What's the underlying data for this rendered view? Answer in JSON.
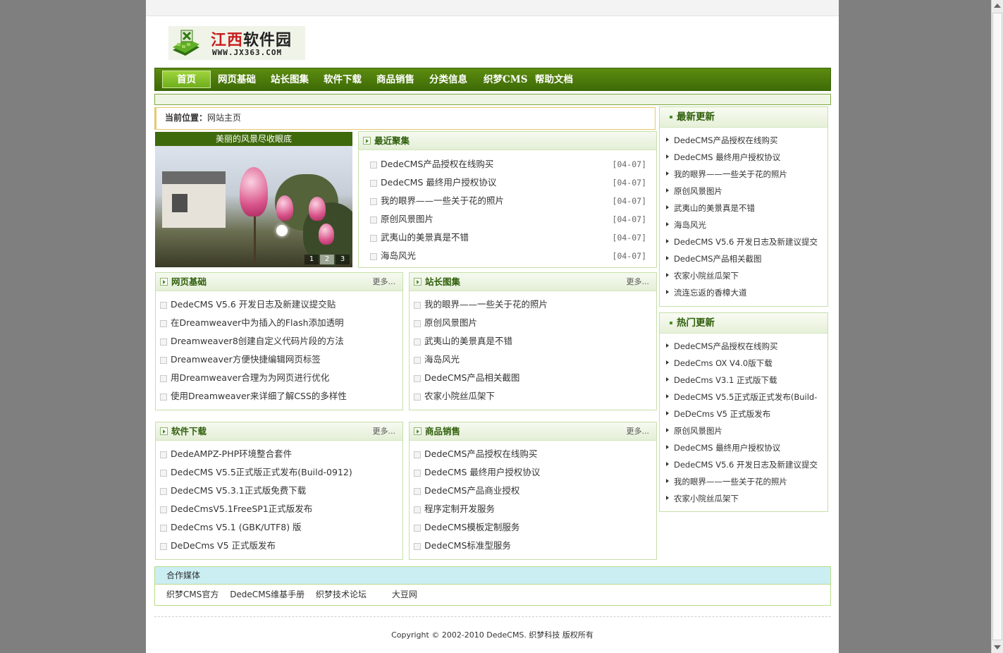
{
  "logo": {
    "title_part1": "江西",
    "title_part2": "软件园",
    "url": "WWW.JX363.COM"
  },
  "nav": [
    "首页",
    "网页基础",
    "站长图集",
    "软件下载",
    "商品销售",
    "分类信息",
    "织梦CMS",
    "帮助文档"
  ],
  "breadcrumb": {
    "label": "当前位置：",
    "value": "网站主页"
  },
  "banner": {
    "caption": "美丽的风景尽收眼底",
    "dots": [
      "1",
      "2",
      "3"
    ]
  },
  "recent": {
    "title": "最近聚集",
    "items": [
      {
        "text": "DedeCMS产品授权在线购买",
        "date": "[04-07]"
      },
      {
        "text": "DedeCMS 最终用户授权协议",
        "date": "[04-07]"
      },
      {
        "text": "我的眼界——一些关于花的照片",
        "date": "[04-07]"
      },
      {
        "text": "原创风景图片",
        "date": "[04-07]"
      },
      {
        "text": "武夷山的美景真是不错",
        "date": "[04-07]"
      },
      {
        "text": "海岛风光",
        "date": "[04-07]"
      }
    ]
  },
  "sections": [
    {
      "title": "网页基础",
      "more": "更多...",
      "items": [
        "DedeCMS V5.6 开发日志及新建议提交贴",
        "在Dreamweaver中为插入的Flash添加透明",
        "Dreamweaver8创建自定义代码片段的方法",
        "Dreamweaver方便快捷编辑网页标签",
        "用Dreamweaver合理为为网页进行优化",
        "使用Dreamweaver来详细了解CSS的多样性"
      ]
    },
    {
      "title": "站长图集",
      "more": "更多...",
      "items": [
        "我的眼界——一些关于花的照片",
        "原创风景图片",
        "武夷山的美景真是不错",
        "海岛风光",
        "DedeCMS产品相关截图",
        "农家小院丝瓜架下"
      ]
    },
    {
      "title": "软件下载",
      "more": "更多...",
      "items": [
        "DedeAMPZ-PHP环境整合套件",
        "DedeCMS V5.5正式版正式发布(Build-0912)",
        "DedeCMS V5.3.1正式版免费下载",
        "DedeCmsV5.1FreeSP1正式版发布",
        "DedeCms V5.1 (GBK/UTF8) 版",
        "DeDeCms V5 正式版发布"
      ]
    },
    {
      "title": "商品销售",
      "more": "更多...",
      "items": [
        "DedeCMS产品授权在线购买",
        "DedeCMS 最终用户授权协议",
        "DedeCMS产品商业授权",
        "程序定制开发服务",
        "DedeCMS模板定制服务",
        "DedeCMS标准型服务"
      ]
    }
  ],
  "latest": {
    "title": "最新更新",
    "items": [
      "DedeCMS产品授权在线购买",
      "DedeCMS 最终用户授权协议",
      "我的眼界——一些关于花的照片",
      "原创风景图片",
      "武夷山的美景真是不错",
      "海岛风光",
      "DedeCMS V5.6 开发日志及新建议提交",
      "DedeCMS产品相关截图",
      "农家小院丝瓜架下",
      "流连忘返的香樟大道"
    ]
  },
  "hot": {
    "title": "热门更新",
    "items": [
      "DedeCMS产品授权在线购买",
      "DedeCms OX V4.0版下载",
      "DedeCms V3.1 正式版下载",
      "DedeCMS V5.5正式版正式发布(Build-",
      "DeDeCms V5 正式版发布",
      "原创风景图片",
      "DedeCMS 最终用户授权协议",
      "DedeCMS V5.6 开发日志及新建议提交",
      "我的眼界——一些关于花的照片",
      "农家小院丝瓜架下"
    ]
  },
  "partner": {
    "title": "合作媒体",
    "links": [
      "织梦CMS官方",
      "DedeCMS维基手册",
      "织梦技术论坛",
      "大豆网"
    ]
  },
  "footer": {
    "copyright": "Copyright © 2002-2010 DedeCMS. 织梦科技 版权所有"
  }
}
